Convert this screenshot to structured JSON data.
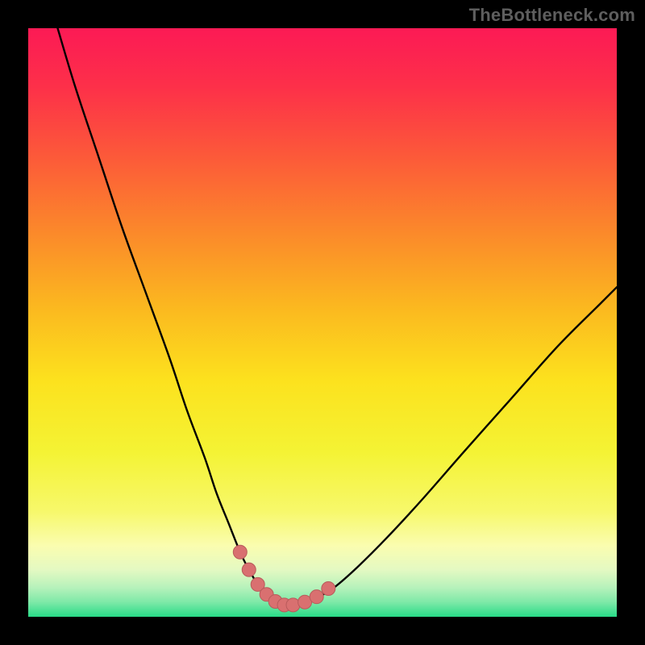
{
  "watermark": "TheBottleneck.com",
  "colors": {
    "frame": "#000000",
    "curve_stroke": "#000000",
    "marker_fill": "#d97070",
    "marker_stroke": "#b85b5b",
    "gradient_stops": [
      {
        "offset": 0.0,
        "color": "#fc1a55"
      },
      {
        "offset": 0.1,
        "color": "#fd3049"
      },
      {
        "offset": 0.22,
        "color": "#fc5a39"
      },
      {
        "offset": 0.35,
        "color": "#fb8a2a"
      },
      {
        "offset": 0.48,
        "color": "#fbba1f"
      },
      {
        "offset": 0.6,
        "color": "#fce21e"
      },
      {
        "offset": 0.72,
        "color": "#f4f334"
      },
      {
        "offset": 0.82,
        "color": "#f7f86a"
      },
      {
        "offset": 0.88,
        "color": "#fafdb0"
      },
      {
        "offset": 0.92,
        "color": "#e4f9c2"
      },
      {
        "offset": 0.95,
        "color": "#b7f2bb"
      },
      {
        "offset": 0.975,
        "color": "#7ee9a8"
      },
      {
        "offset": 1.0,
        "color": "#29db87"
      }
    ]
  },
  "chart_data": {
    "type": "line",
    "title": "",
    "xlabel": "",
    "ylabel": "",
    "xlim": [
      0,
      100
    ],
    "ylim": [
      0,
      100
    ],
    "grid": false,
    "series": [
      {
        "name": "bottleneck-curve",
        "x": [
          5,
          8,
          12,
          16,
          20,
          24,
          27,
          30,
          32,
          34,
          36,
          37.5,
          39,
          40.5,
          42,
          43.5,
          45,
          47,
          49,
          52,
          56,
          61,
          67,
          74,
          82,
          90,
          97,
          100
        ],
        "values": [
          100,
          90,
          78,
          66,
          55,
          44,
          35,
          27,
          21,
          16,
          11,
          8,
          5.5,
          3.8,
          2.6,
          2.0,
          2.0,
          2.3,
          3.2,
          5.0,
          8.5,
          13.5,
          20,
          28,
          37,
          46,
          53,
          56
        ]
      }
    ],
    "markers": {
      "name": "highlighted-points",
      "x": [
        36.0,
        37.5,
        39.0,
        40.5,
        42.0,
        43.5,
        45.0,
        47.0,
        49.0,
        51.0
      ],
      "values": [
        11.0,
        8.0,
        5.5,
        3.8,
        2.6,
        2.0,
        2.0,
        2.5,
        3.4,
        4.8
      ]
    }
  }
}
